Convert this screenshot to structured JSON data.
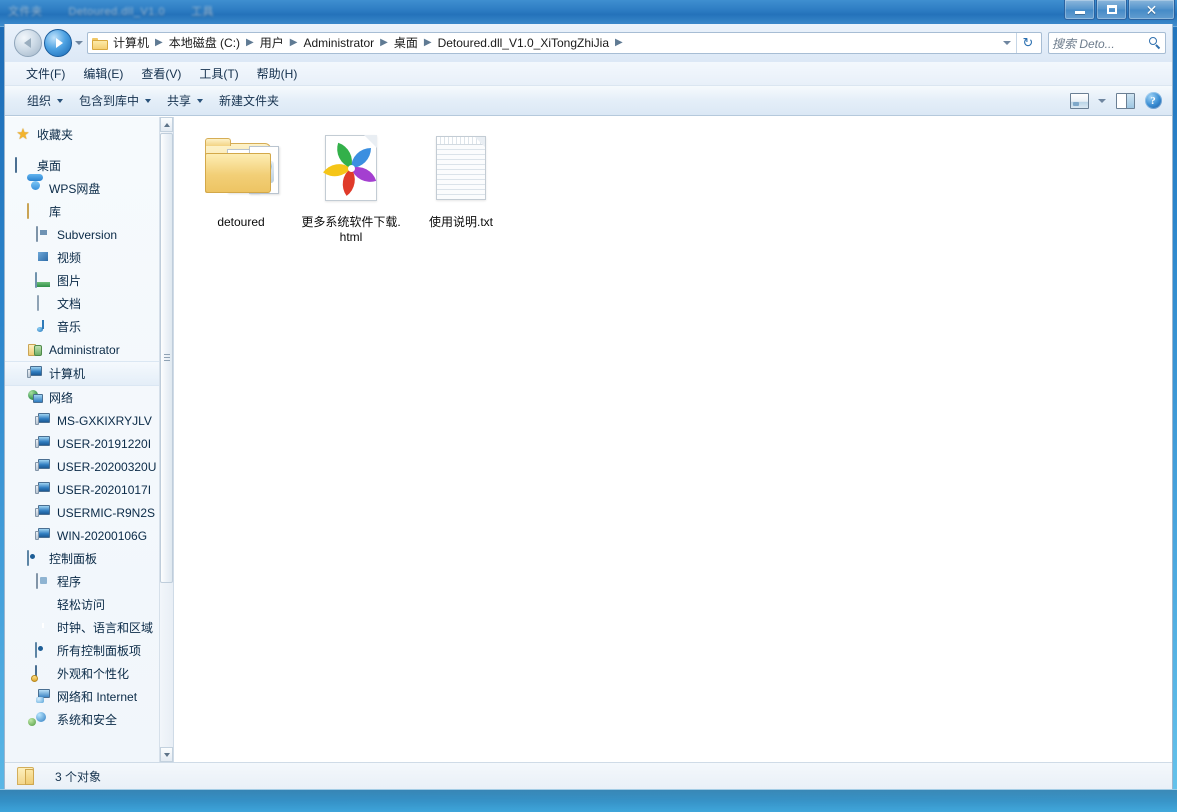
{
  "window": {
    "title_fragments": [
      "文件夹",
      "Detoured.dll_V1.0",
      "工具"
    ],
    "controls": {
      "minimize": "最小化",
      "maximize": "最大化",
      "close": "关闭"
    }
  },
  "addressbar": {
    "back_tooltip": "后退",
    "forward_tooltip": "前进",
    "history_tooltip": "最近浏览的页面",
    "breadcrumbs": [
      "计算机",
      "本地磁盘 (C:)",
      "用户",
      "Administrator",
      "桌面",
      "Detoured.dll_V1.0_XiTongZhiJia"
    ],
    "separator": "▶",
    "dropdown_tooltip": "以前的位置",
    "refresh_tooltip": "刷新",
    "refresh_glyph": "↻"
  },
  "search": {
    "placeholder": "搜索 Deto...",
    "icon": "search-icon"
  },
  "menubar": {
    "items": [
      {
        "label": "文件(F)"
      },
      {
        "label": "编辑(E)"
      },
      {
        "label": "查看(V)"
      },
      {
        "label": "工具(T)"
      },
      {
        "label": "帮助(H)"
      }
    ]
  },
  "toolbar": {
    "items": [
      {
        "label": "组织",
        "has_caret": true
      },
      {
        "label": "包含到库中",
        "has_caret": true
      },
      {
        "label": "共享",
        "has_caret": true
      },
      {
        "label": "新建文件夹",
        "has_caret": false
      }
    ],
    "right_buttons": [
      {
        "name": "change-view-icon",
        "tooltip": "更改您的视图"
      },
      {
        "name": "view-dropdown-icon",
        "tooltip": "更多选项"
      },
      {
        "name": "preview-pane-icon",
        "tooltip": "显示预览窗格"
      },
      {
        "name": "help-icon",
        "tooltip": "获取帮助",
        "glyph": "?"
      }
    ]
  },
  "sidebar": {
    "groups": [
      {
        "items": [
          {
            "label": "收藏夹",
            "icon": "star-icon",
            "indent": 0,
            "selected": false
          }
        ]
      },
      {
        "items": [
          {
            "label": "桌面",
            "icon": "monitor-icon",
            "indent": 0,
            "selected": false
          },
          {
            "label": "WPS网盘",
            "icon": "cloud-icon",
            "indent": 1,
            "selected": false
          },
          {
            "label": "库",
            "icon": "library-icon",
            "indent": 1,
            "selected": false
          },
          {
            "label": "Subversion",
            "icon": "subversion-icon",
            "indent": 2,
            "selected": false
          },
          {
            "label": "视频",
            "icon": "video-icon",
            "indent": 2,
            "selected": false
          },
          {
            "label": "图片",
            "icon": "pictures-icon",
            "indent": 2,
            "selected": false
          },
          {
            "label": "文档",
            "icon": "documents-icon",
            "indent": 2,
            "selected": false
          },
          {
            "label": "音乐",
            "icon": "music-icon",
            "indent": 2,
            "selected": false
          },
          {
            "label": "Administrator",
            "icon": "user-icon",
            "indent": 1,
            "selected": false
          },
          {
            "label": "计算机",
            "icon": "computer-icon",
            "indent": 1,
            "selected": true
          },
          {
            "label": "网络",
            "icon": "network-icon",
            "indent": 1,
            "selected": false
          },
          {
            "label": "MS-GXKIXRYJLV",
            "icon": "computer-icon",
            "indent": 2,
            "selected": false
          },
          {
            "label": "USER-20191220I",
            "icon": "computer-icon",
            "indent": 2,
            "selected": false
          },
          {
            "label": "USER-20200320U",
            "icon": "computer-icon",
            "indent": 2,
            "selected": false
          },
          {
            "label": "USER-20201017I",
            "icon": "computer-icon",
            "indent": 2,
            "selected": false
          },
          {
            "label": "USERMIC-R9N2S",
            "icon": "computer-icon",
            "indent": 2,
            "selected": false
          },
          {
            "label": "WIN-20200106G",
            "icon": "computer-icon",
            "indent": 2,
            "selected": false
          },
          {
            "label": "控制面板",
            "icon": "control-panel-icon",
            "indent": 1,
            "selected": false
          },
          {
            "label": "程序",
            "icon": "programs-icon",
            "indent": 2,
            "selected": false
          },
          {
            "label": "轻松访问",
            "icon": "ease-of-access-icon",
            "indent": 2,
            "selected": false
          },
          {
            "label": "时钟、语言和区域",
            "icon": "clock-language-icon",
            "indent": 2,
            "selected": false
          },
          {
            "label": "所有控制面板项",
            "icon": "all-control-panel-icon",
            "indent": 2,
            "selected": false
          },
          {
            "label": "外观和个性化",
            "icon": "appearance-icon",
            "indent": 2,
            "selected": false
          },
          {
            "label": "网络和 Internet",
            "icon": "network-internet-icon",
            "indent": 2,
            "selected": false
          },
          {
            "label": "系统和安全",
            "icon": "system-security-icon",
            "indent": 2,
            "selected": false
          }
        ]
      }
    ],
    "scrollbar": {
      "up_arrow": "▲",
      "down_arrow": "▼"
    }
  },
  "files": [
    {
      "name": "detoured",
      "type": "folder",
      "icon": "folder-with-thumbnails-icon"
    },
    {
      "name": "更多系统软件下载.html",
      "type": "html",
      "icon": "pinwheel-browser-document-icon",
      "petal_colors": [
        "#3b8fe0",
        "#a43fd0",
        "#e03a2a",
        "#f5c518",
        "#33b04a"
      ]
    },
    {
      "name": "使用说明.txt",
      "type": "txt",
      "icon": "notepad-document-icon"
    }
  ],
  "statusbar": {
    "icon": "open-folder-icon",
    "text": "3 个对象"
  },
  "colors": {
    "accent": "#2472ba",
    "window_bg": "#ffffff",
    "chrome_bg": "#e4eef8",
    "desktop_top": "#1b69b4",
    "desktop_bottom": "#66c4ec",
    "folder_yellow": "#f3d68c",
    "selected_row": "#e4eef8"
  }
}
